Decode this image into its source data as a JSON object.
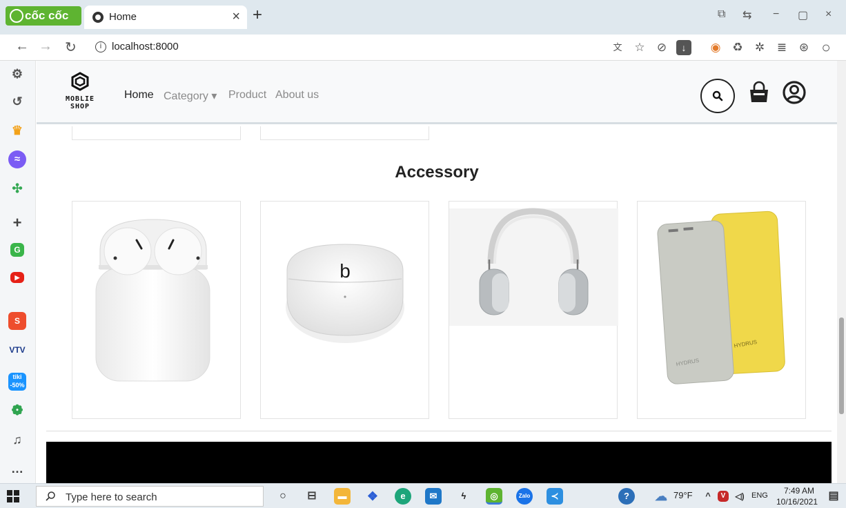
{
  "browser": {
    "brand": "cốc cốc",
    "tab_title": "Home",
    "tab_close": "×",
    "new_tab": "+",
    "url": "localhost:8000",
    "window_controls": [
      "−",
      "▢",
      "×"
    ]
  },
  "site": {
    "logo_line1": "MOBLIE",
    "logo_line2": "SHOP",
    "nav": [
      {
        "label": "Home",
        "active": true
      },
      {
        "label": "Category ▾",
        "active": false
      },
      {
        "label": "Product",
        "active": false
      },
      {
        "label": "About us",
        "active": false
      }
    ],
    "section_title": "Accessory",
    "products": [
      {
        "name": "airpods-with-case",
        "image_icon": "airpods-image"
      },
      {
        "name": "beats-earbuds-case",
        "image_icon": "beats-case-image"
      },
      {
        "name": "over-ear-headphones",
        "image_icon": "headphones-image"
      },
      {
        "name": "power-banks",
        "image_icon": "power-bank-image"
      }
    ],
    "beats_logo": "b",
    "powerbank_brand": "HYDRUS"
  },
  "taskbar": {
    "search_placeholder": "Type here to search",
    "weather": "79°F",
    "language": "ENG",
    "time": "7:49 AM",
    "date": "10/16/2021"
  },
  "colors": {
    "browser_green": "#5eb431",
    "header_bg": "#f8f9fa",
    "footer_bg": "#000000",
    "powerbank_yellow": "#f0d84a",
    "powerbank_grey": "#c9cbc4"
  }
}
